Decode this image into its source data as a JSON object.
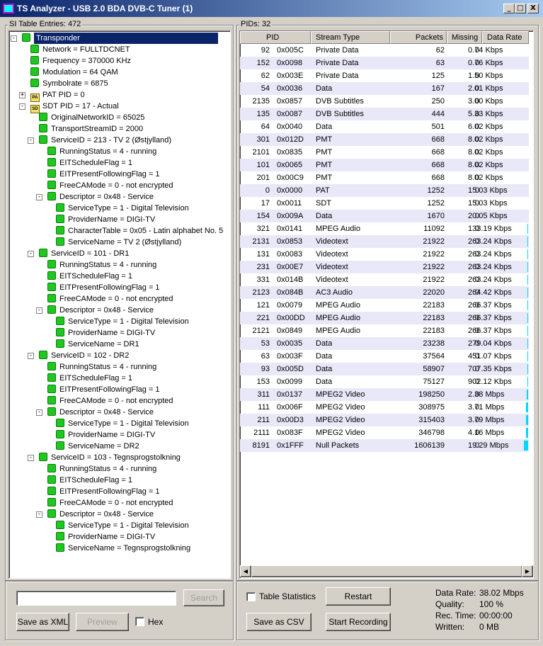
{
  "window": {
    "title": "TS Analyzer - USB 2.0 BDA DVB-C Tuner (1)",
    "minimize": "_",
    "maximize": "□",
    "close": "X"
  },
  "left": {
    "group_label": "SI Table Entries: 472",
    "tree": [
      {
        "text": "Transponder",
        "lvl": 0,
        "exp": "-",
        "sel": true
      },
      {
        "text": "Network = FULLTDCNET",
        "lvl": 1
      },
      {
        "text": "Frequency = 370000 KHz",
        "lvl": 1
      },
      {
        "text": "Modulation = 64 QAM",
        "lvl": 1
      },
      {
        "text": "Symbolrate = 6875",
        "lvl": 1
      },
      {
        "text": "PAT PID = 0",
        "lvl": 1,
        "exp": "+",
        "icon": "PA"
      },
      {
        "text": "SDT PID = 17 - Actual",
        "lvl": 1,
        "exp": "-",
        "icon": "SD"
      },
      {
        "text": "OriginalNetworkID = 65025",
        "lvl": 2
      },
      {
        "text": "TransportStreamID = 2000",
        "lvl": 2
      },
      {
        "text": "ServiceID = 213 - TV 2 (Østjylland)",
        "lvl": 2,
        "exp": "-"
      },
      {
        "text": "RunningStatus = 4 - running",
        "lvl": 3
      },
      {
        "text": "EITScheduleFlag = 1",
        "lvl": 3
      },
      {
        "text": "EITPresentFollowingFlag = 1",
        "lvl": 3
      },
      {
        "text": "FreeCAMode = 0 - not encrypted",
        "lvl": 3
      },
      {
        "text": "Descriptor = 0x48 - Service",
        "lvl": 3,
        "exp": "-"
      },
      {
        "text": "ServiceType = 1 - Digital Television",
        "lvl": 4
      },
      {
        "text": "ProviderName = DIGI-TV",
        "lvl": 4
      },
      {
        "text": "CharacterTable = 0x05 - Latin alphabet No. 5",
        "lvl": 4
      },
      {
        "text": "ServiceName = TV 2 (Østjylland)",
        "lvl": 4
      },
      {
        "text": "ServiceID = 101 - DR1",
        "lvl": 2,
        "exp": "-"
      },
      {
        "text": "RunningStatus = 4 - running",
        "lvl": 3
      },
      {
        "text": "EITScheduleFlag = 1",
        "lvl": 3
      },
      {
        "text": "EITPresentFollowingFlag = 1",
        "lvl": 3
      },
      {
        "text": "FreeCAMode = 0 - not encrypted",
        "lvl": 3
      },
      {
        "text": "Descriptor = 0x48 - Service",
        "lvl": 3,
        "exp": "-"
      },
      {
        "text": "ServiceType = 1 - Digital Television",
        "lvl": 4
      },
      {
        "text": "ProviderName = DIGI-TV",
        "lvl": 4
      },
      {
        "text": "ServiceName = DR1",
        "lvl": 4
      },
      {
        "text": "ServiceID = 102 - DR2",
        "lvl": 2,
        "exp": "-"
      },
      {
        "text": "RunningStatus = 4 - running",
        "lvl": 3
      },
      {
        "text": "EITScheduleFlag = 1",
        "lvl": 3
      },
      {
        "text": "EITPresentFollowingFlag = 1",
        "lvl": 3
      },
      {
        "text": "FreeCAMode = 0 - not encrypted",
        "lvl": 3
      },
      {
        "text": "Descriptor = 0x48 - Service",
        "lvl": 3,
        "exp": "-"
      },
      {
        "text": "ServiceType = 1 - Digital Television",
        "lvl": 4
      },
      {
        "text": "ProviderName = DIGI-TV",
        "lvl": 4
      },
      {
        "text": "ServiceName = DR2",
        "lvl": 4
      },
      {
        "text": "ServiceID = 103 - Tegnsprogstolkning",
        "lvl": 2,
        "exp": "-"
      },
      {
        "text": "RunningStatus = 4 - running",
        "lvl": 3
      },
      {
        "text": "EITScheduleFlag = 1",
        "lvl": 3
      },
      {
        "text": "EITPresentFollowingFlag = 1",
        "lvl": 3
      },
      {
        "text": "FreeCAMode = 0 - not encrypted",
        "lvl": 3
      },
      {
        "text": "Descriptor = 0x48 - Service",
        "lvl": 3,
        "exp": "-"
      },
      {
        "text": "ServiceType = 1 - Digital Television",
        "lvl": 4
      },
      {
        "text": "ProviderName = DIGI-TV",
        "lvl": 4
      },
      {
        "text": "ServiceName = Tegnsprogstolkning",
        "lvl": 4
      }
    ],
    "search_value": "",
    "search_button": "Search",
    "save_xml_button": "Save as XML",
    "preview_button": "Preview",
    "hex_label": "Hex"
  },
  "right": {
    "group_label": "PIDs: 32",
    "columns": [
      "PID",
      "Stream Type",
      "Packets",
      "Missing",
      "Data Rate"
    ],
    "rows": [
      [
        "92",
        "0x005C",
        "Private Data",
        "62",
        "0",
        "0.74 Kbps"
      ],
      [
        "152",
        "0x0098",
        "Private Data",
        "63",
        "0",
        "0.76 Kbps"
      ],
      [
        "62",
        "0x003E",
        "Private Data",
        "125",
        "0",
        "1.50 Kbps"
      ],
      [
        "54",
        "0x0036",
        "Data",
        "167",
        "0",
        "2.01 Kbps"
      ],
      [
        "2135",
        "0x0857",
        "DVB Subtitles",
        "250",
        "0",
        "3.00 Kbps"
      ],
      [
        "135",
        "0x0087",
        "DVB Subtitles",
        "444",
        "0",
        "5.33 Kbps"
      ],
      [
        "64",
        "0x0040",
        "Data",
        "501",
        "0",
        "6.02 Kbps"
      ],
      [
        "301",
        "0x012D",
        "PMT",
        "668",
        "0",
        "8.02 Kbps"
      ],
      [
        "2101",
        "0x0835",
        "PMT",
        "668",
        "0",
        "8.02 Kbps"
      ],
      [
        "101",
        "0x0065",
        "PMT",
        "668",
        "0",
        "8.02 Kbps"
      ],
      [
        "201",
        "0x00C9",
        "PMT",
        "668",
        "0",
        "8.02 Kbps"
      ],
      [
        "0",
        "0x0000",
        "PAT",
        "1252",
        "0",
        "15.03 Kbps"
      ],
      [
        "17",
        "0x0011",
        "SDT",
        "1252",
        "0",
        "15.03 Kbps"
      ],
      [
        "154",
        "0x009A",
        "Data",
        "1670",
        "0",
        "20.05 Kbps"
      ],
      [
        "321",
        "0x0141",
        "MPEG Audio",
        "11092",
        "0",
        "133.19 Kbps"
      ],
      [
        "2131",
        "0x0853",
        "Videotext",
        "21922",
        "0",
        "263.24 Kbps"
      ],
      [
        "131",
        "0x0083",
        "Videotext",
        "21922",
        "0",
        "263.24 Kbps"
      ],
      [
        "231",
        "0x00E7",
        "Videotext",
        "21922",
        "0",
        "263.24 Kbps"
      ],
      [
        "331",
        "0x014B",
        "Videotext",
        "21922",
        "0",
        "263.24 Kbps"
      ],
      [
        "2123",
        "0x084B",
        "AC3 Audio",
        "22020",
        "0",
        "264.42 Kbps"
      ],
      [
        "121",
        "0x0079",
        "MPEG Audio",
        "22183",
        "0",
        "266.37 Kbps"
      ],
      [
        "221",
        "0x00DD",
        "MPEG Audio",
        "22183",
        "0",
        "266.37 Kbps"
      ],
      [
        "2121",
        "0x0849",
        "MPEG Audio",
        "22183",
        "0",
        "266.37 Kbps"
      ],
      [
        "53",
        "0x0035",
        "Data",
        "23238",
        "0",
        "279.04 Kbps"
      ],
      [
        "63",
        "0x003F",
        "Data",
        "37564",
        "0",
        "451.07 Kbps"
      ],
      [
        "93",
        "0x005D",
        "Data",
        "58907",
        "0",
        "707.35 Kbps"
      ],
      [
        "153",
        "0x0099",
        "Data",
        "75127",
        "0",
        "902.12 Kbps"
      ],
      [
        "311",
        "0x0137",
        "MPEG2 Video",
        "198250",
        "0",
        "2.38 Mbps"
      ],
      [
        "111",
        "0x006F",
        "MPEG2 Video",
        "308975",
        "0",
        "3.71 Mbps"
      ],
      [
        "211",
        "0x00D3",
        "MPEG2 Video",
        "315403",
        "0",
        "3.79 Mbps"
      ],
      [
        "2111",
        "0x083F",
        "MPEG2 Video",
        "346798",
        "0",
        "4.16 Mbps"
      ],
      [
        "8191",
        "0x1FFF",
        "Null Packets",
        "1606139",
        "0",
        "19.29 Mbps"
      ]
    ],
    "table_stats_label": "Table Statistics",
    "restart_button": "Restart",
    "save_csv_button": "Save as CSV",
    "start_recording_button": "Start Recording",
    "stats": {
      "data_rate_label": "Data Rate:",
      "data_rate": "38.02 Mbps",
      "quality_label": "Quality:",
      "quality": "100 %",
      "rec_time_label": "Rec. Time:",
      "rec_time": "00:00:00",
      "written_label": "Written:",
      "written": "0 MB"
    },
    "bar_color": "#00d8ff",
    "alt_row_color": "#e8e8f8"
  }
}
